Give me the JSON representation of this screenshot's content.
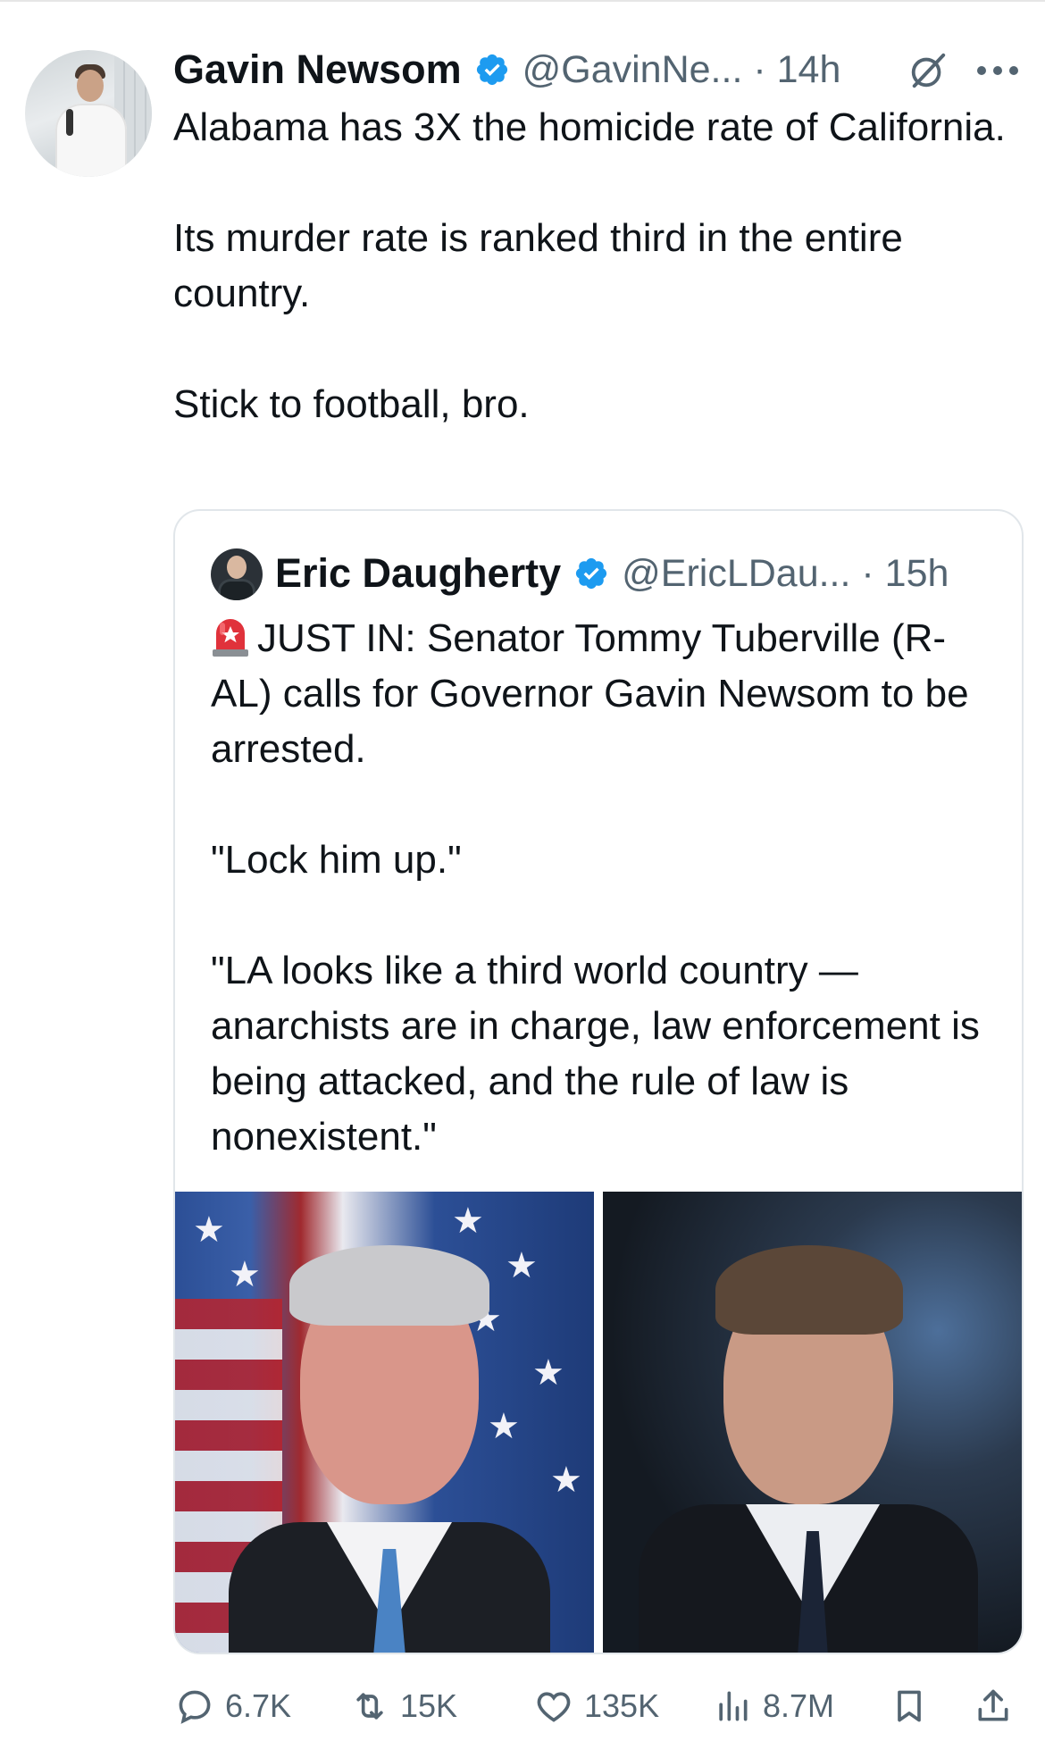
{
  "tweet": {
    "author_name": "Gavin Newsom",
    "author_handle": "@GavinNe...",
    "time": "14h",
    "text": [
      "Alabama has 3X the homicide rate of California.",
      "Its murder rate is ranked third in the entire country.",
      "Stick to football, bro."
    ]
  },
  "quote": {
    "author_name": "Eric Daugherty",
    "author_handle": "@EricLDau...",
    "time": "15h",
    "text": [
      "JUST IN: Senator Tommy Tuberville (R-AL) calls for Governor Gavin Newsom to be arrested.",
      "\"Lock him up.\"",
      "\"LA looks like a third world country — anarchists are in charge, law enforcement is being attacked, and the rule of law is nonexistent.\""
    ]
  },
  "actions": {
    "replies": "6.7K",
    "reposts": "15K",
    "likes": "135K",
    "views": "8.7M"
  },
  "colors": {
    "verified_blue": "#1d9bf0",
    "secondary_text": "#536471",
    "primary_text": "#0f1419"
  },
  "icons": [
    "verified-badge-icon",
    "grok-icon",
    "more-options-icon",
    "siren-emoji-icon",
    "reply-icon",
    "repost-icon",
    "like-icon",
    "views-icon",
    "bookmark-icon",
    "share-icon"
  ]
}
